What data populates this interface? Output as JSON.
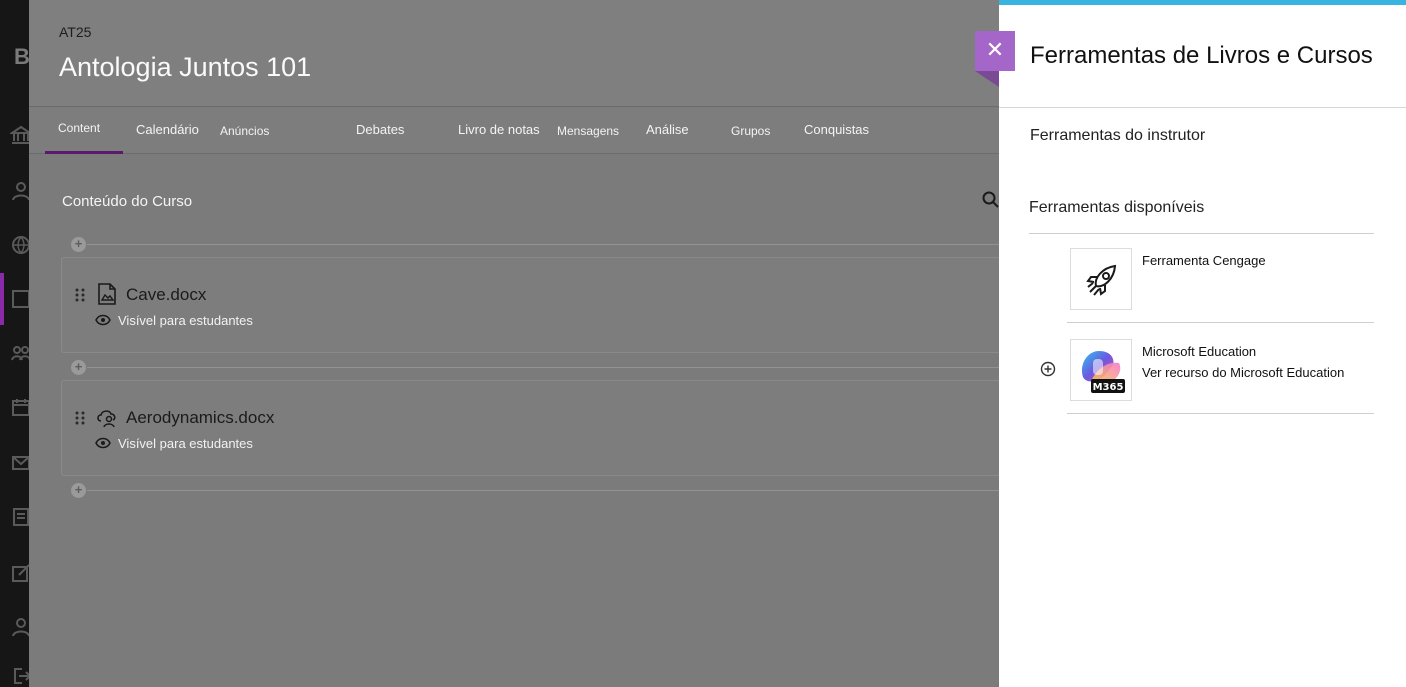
{
  "app": {
    "brand": "B"
  },
  "course": {
    "code": "AT25",
    "title": "Antologia Juntos 101",
    "tabs": [
      {
        "label": "Content"
      },
      {
        "label": "Calendário"
      },
      {
        "label": "Anúncios"
      },
      {
        "label": "Debates"
      },
      {
        "label": "Livro de notas"
      },
      {
        "label": "Mensagens"
      },
      {
        "label": "Análise"
      },
      {
        "label": "Grupos"
      },
      {
        "label": "Conquistas"
      }
    ],
    "section_title": "Conteúdo do Curso",
    "items": [
      {
        "name": "Cave.docx",
        "visibility": "Visível para estudantes",
        "icon": "document-image-icon"
      },
      {
        "name": "Aerodynamics.docx",
        "visibility": "Visível para estudantes",
        "icon": "cloud-person-icon"
      }
    ]
  },
  "panel": {
    "title": "Ferramentas de Livros e Cursos",
    "instructor_tools": "Ferramentas do instrutor",
    "available_tools": "Ferramentas disponíveis",
    "tools": [
      {
        "name": "Ferramenta Cengage",
        "desc": "",
        "icon": "rocket-icon"
      },
      {
        "name": "Microsoft Education",
        "desc": "Ver recurso do Microsoft Education",
        "icon": "m365-icon",
        "badge": "M365"
      }
    ],
    "accent": "#a566c9",
    "topbar_color": "#39b4e0"
  }
}
